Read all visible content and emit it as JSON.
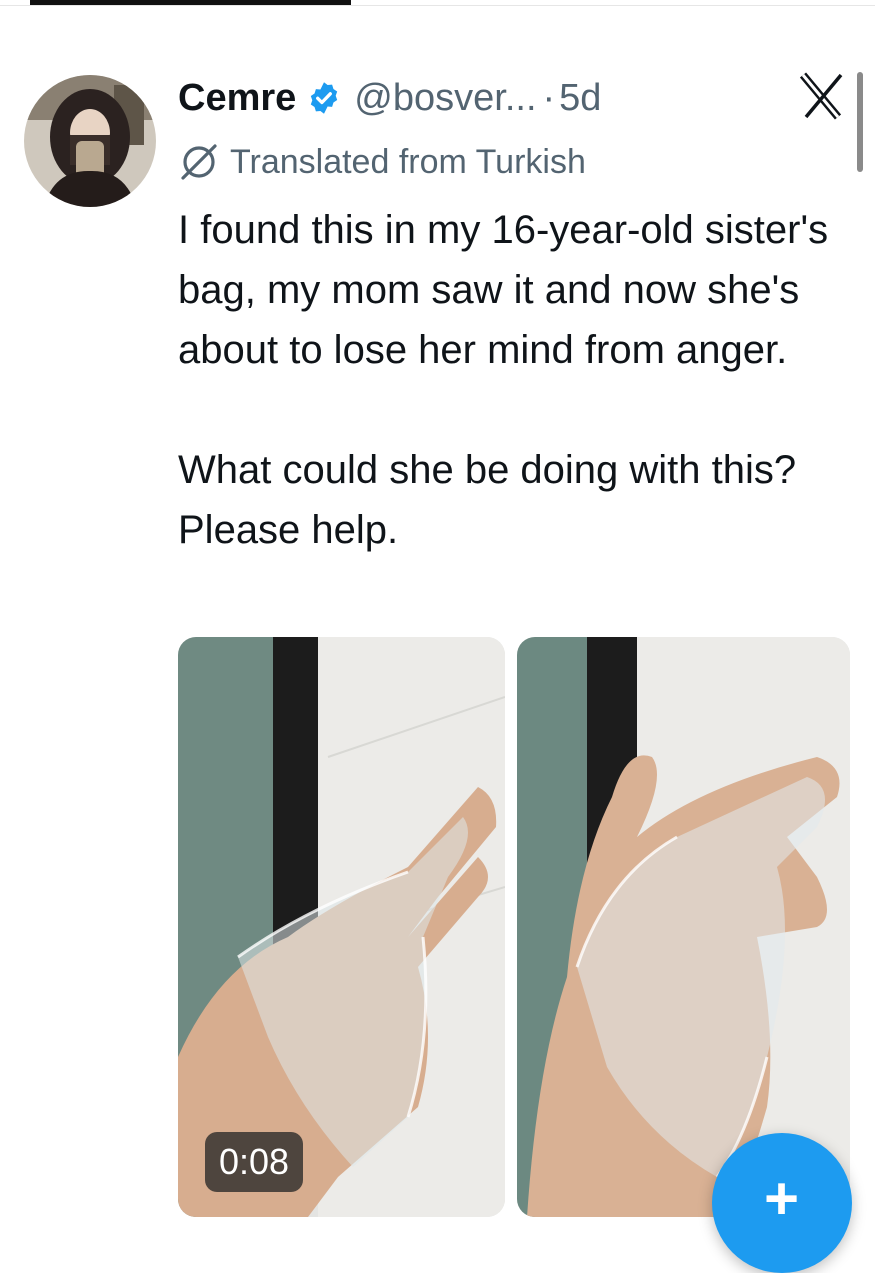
{
  "tweet": {
    "author": {
      "name": "Cemre",
      "handle": "@bosver...",
      "verified": true,
      "avatar": "avatar-photo"
    },
    "separator": "·",
    "timestamp": "5d",
    "translation_notice": "Translated from Turkish",
    "text": {
      "paragraph_1": "I found this in my 16-year-old sister's bag, my mom saw it and now she's about to lose her mind from anger.",
      "paragraph_2": "What could she be doing with this? Please help."
    },
    "media": [
      {
        "type": "video",
        "duration": "0:08",
        "content": "hand-wearing-clear-silicone-lace-glove"
      },
      {
        "type": "image",
        "content": "hand-wearing-clear-silicone-lace-glove"
      }
    ]
  },
  "icons": {
    "verified": "verified-badge-icon",
    "translate": "translate-icon",
    "close": "x-logo-icon",
    "compose": "plus-icon"
  },
  "compose_button": {
    "label": "+"
  },
  "colors": {
    "text_primary": "#0f1419",
    "text_secondary": "#536471",
    "verified_blue": "#1d9bf0",
    "compose_blue": "#1d9bf0",
    "background": "#ffffff"
  }
}
